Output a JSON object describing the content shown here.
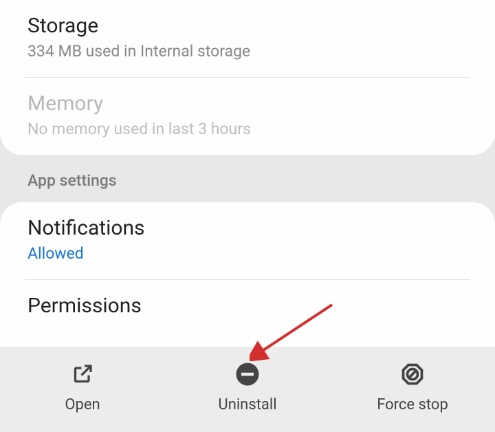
{
  "usage": {
    "storage": {
      "title": "Storage",
      "sub": "334 MB used in Internal storage"
    },
    "memory": {
      "title": "Memory",
      "sub": "No memory used in last 3 hours"
    }
  },
  "sectionHeader": "App settings",
  "settings": {
    "notifications": {
      "title": "Notifications",
      "status": "Allowed"
    },
    "permissions": {
      "title": "Permissions"
    }
  },
  "actions": {
    "open": "Open",
    "uninstall": "Uninstall",
    "forceStop": "Force stop"
  }
}
